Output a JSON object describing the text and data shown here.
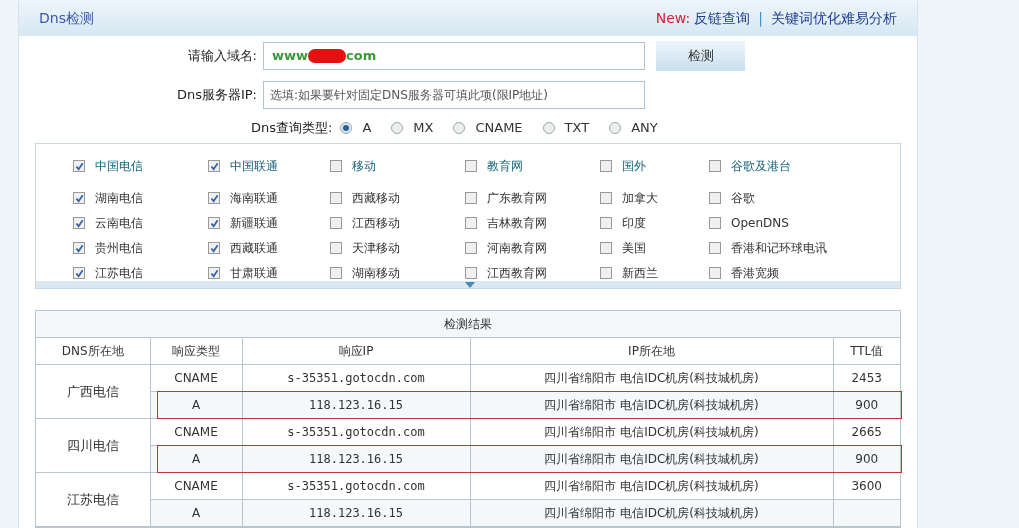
{
  "header": {
    "title": "Dns检测",
    "new_label": "New:",
    "links": [
      "反链查询",
      "关键词优化难易分析"
    ],
    "separator": "|"
  },
  "form": {
    "domain_label": "请输入域名:",
    "domain_value_start": "www",
    "domain_value_end": "com",
    "domain_redacted": true,
    "submit": "检测",
    "server_label": "Dns服务器IP:",
    "server_placeholder": "选填:如果要针对固定DNS服务器可填此项(限IP地址)",
    "type_label": "Dns查询类型:",
    "types": [
      {
        "label": "A",
        "selected": true
      },
      {
        "label": "MX",
        "selected": false
      },
      {
        "label": "CNAME",
        "selected": false
      },
      {
        "label": "TXT",
        "selected": false
      },
      {
        "label": "ANY",
        "selected": false
      }
    ]
  },
  "groups": [
    {
      "label": "中国电信",
      "checked": true,
      "items": [
        {
          "label": "湖南电信",
          "checked": true
        },
        {
          "label": "云南电信",
          "checked": true
        },
        {
          "label": "贵州电信",
          "checked": true
        },
        {
          "label": "江苏电信",
          "checked": true
        }
      ]
    },
    {
      "label": "中国联通",
      "checked": true,
      "items": [
        {
          "label": "海南联通",
          "checked": true
        },
        {
          "label": "新疆联通",
          "checked": true
        },
        {
          "label": "西藏联通",
          "checked": true
        },
        {
          "label": "甘肃联通",
          "checked": true
        }
      ]
    },
    {
      "label": "移动",
      "checked": false,
      "items": [
        {
          "label": "西藏移动",
          "checked": false
        },
        {
          "label": "江西移动",
          "checked": false
        },
        {
          "label": "天津移动",
          "checked": false
        },
        {
          "label": "湖南移动",
          "checked": false
        }
      ]
    },
    {
      "label": "教育网",
      "checked": false,
      "items": [
        {
          "label": "广东教育网",
          "checked": false
        },
        {
          "label": "吉林教育网",
          "checked": false
        },
        {
          "label": "河南教育网",
          "checked": false
        },
        {
          "label": "江西教育网",
          "checked": false
        }
      ]
    },
    {
      "label": "国外",
      "checked": false,
      "items": [
        {
          "label": "加拿大",
          "checked": false
        },
        {
          "label": "印度",
          "checked": false
        },
        {
          "label": "美国",
          "checked": false
        },
        {
          "label": "新西兰",
          "checked": false
        }
      ]
    },
    {
      "label": "谷歌及港台",
      "checked": false,
      "items": [
        {
          "label": "谷歌",
          "checked": false
        },
        {
          "label": "OpenDNS",
          "checked": false
        },
        {
          "label": "香港和记环球电讯",
          "checked": false
        },
        {
          "label": "香港宽频",
          "checked": false
        }
      ]
    }
  ],
  "results": {
    "title": "检测结果",
    "columns": [
      "DNS所在地",
      "响应类型",
      "响应IP",
      "IP所在地",
      "TTL值"
    ],
    "groups": [
      {
        "location": "广西电信",
        "records": [
          {
            "type": "CNAME",
            "ip": "s-35351.gotocdn.com",
            "place": "四川省绵阳市 电信IDC机房(科技城机房)",
            "ttl": "2453",
            "highlighted": false
          },
          {
            "type": "A",
            "ip": "118.123.16.15",
            "place": "四川省绵阳市 电信IDC机房(科技城机房)",
            "ttl": "900",
            "highlighted": true
          }
        ]
      },
      {
        "location": "四川电信",
        "records": [
          {
            "type": "CNAME",
            "ip": "s-35351.gotocdn.com",
            "place": "四川省绵阳市 电信IDC机房(科技城机房)",
            "ttl": "2665",
            "highlighted": false
          },
          {
            "type": "A",
            "ip": "118.123.16.15",
            "place": "四川省绵阳市 电信IDC机房(科技城机房)",
            "ttl": "900",
            "highlighted": true
          }
        ]
      },
      {
        "location": "江苏电信",
        "records": [
          {
            "type": "CNAME",
            "ip": "s-35351.gotocdn.com",
            "place": "四川省绵阳市 电信IDC机房(科技城机房)",
            "ttl": "3600",
            "highlighted": false
          },
          {
            "type": "A",
            "ip": "118.123.16.15",
            "place": "四川省绵阳市 电信IDC机房(科技城机房)",
            "highlighted": false
          }
        ]
      }
    ]
  }
}
